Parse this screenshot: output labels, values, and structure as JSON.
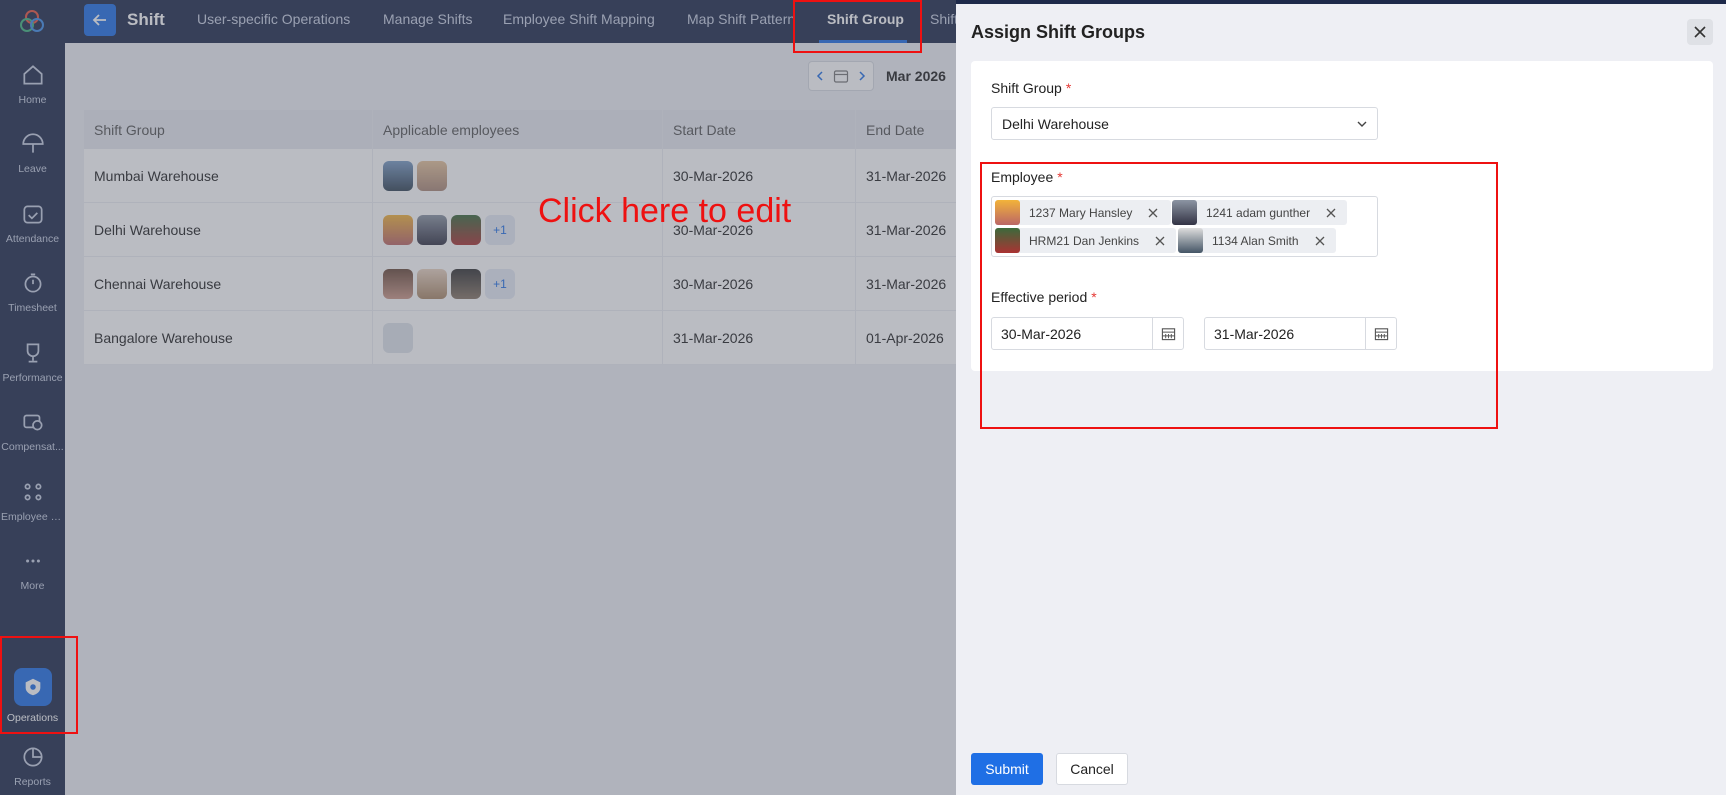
{
  "app": {
    "title": "Shift"
  },
  "sidebar": {
    "items": [
      {
        "label": "Home"
      },
      {
        "label": "Leave"
      },
      {
        "label": "Attendance"
      },
      {
        "label": "Timesheet"
      },
      {
        "label": "Performance"
      },
      {
        "label": "Compensat..."
      },
      {
        "label": "Employee E..."
      },
      {
        "label": "More"
      },
      {
        "label": "Operations"
      },
      {
        "label": "Reports"
      }
    ]
  },
  "tabs": [
    {
      "label": "User-specific Operations"
    },
    {
      "label": "Manage Shifts"
    },
    {
      "label": "Employee Shift Mapping"
    },
    {
      "label": "Map Shift Pattern"
    },
    {
      "label": "Shift Group"
    },
    {
      "label": "Shift"
    }
  ],
  "date_nav": {
    "month": "Mar 2026"
  },
  "table": {
    "headers": [
      "Shift Group",
      "Applicable employees",
      "Start Date",
      "End Date"
    ],
    "rows": [
      {
        "group": "Mumbai Warehouse",
        "extra": "",
        "start": "30-Mar-2026",
        "end": "31-Mar-2026"
      },
      {
        "group": "Delhi Warehouse",
        "extra": "+1",
        "start": "30-Mar-2026",
        "end": "31-Mar-2026"
      },
      {
        "group": "Chennai Warehouse",
        "extra": "+1",
        "start": "30-Mar-2026",
        "end": "31-Mar-2026"
      },
      {
        "group": "Bangalore Warehouse",
        "extra": "",
        "start": "31-Mar-2026",
        "end": "01-Apr-2026"
      }
    ]
  },
  "annotation": {
    "text": "Click here to edit"
  },
  "drawer": {
    "title": "Assign Shift Groups",
    "shift_group_label": "Shift Group",
    "shift_group_value": "Delhi Warehouse",
    "employee_label": "Employee",
    "employees": [
      {
        "name": "1237 Mary Hansley"
      },
      {
        "name": "1241 adam gunther"
      },
      {
        "name": "HRM21 Dan Jenkins"
      },
      {
        "name": "1134 Alan Smith"
      }
    ],
    "effective_label": "Effective period",
    "start_date": "30-Mar-2026",
    "end_date": "31-Mar-2026",
    "required_mark": "*",
    "submit_label": "Submit",
    "cancel_label": "Cancel"
  },
  "colors": {
    "sidebar": "#1e2a4a",
    "accent": "#1f6fe5",
    "annotation": "#e11111"
  }
}
